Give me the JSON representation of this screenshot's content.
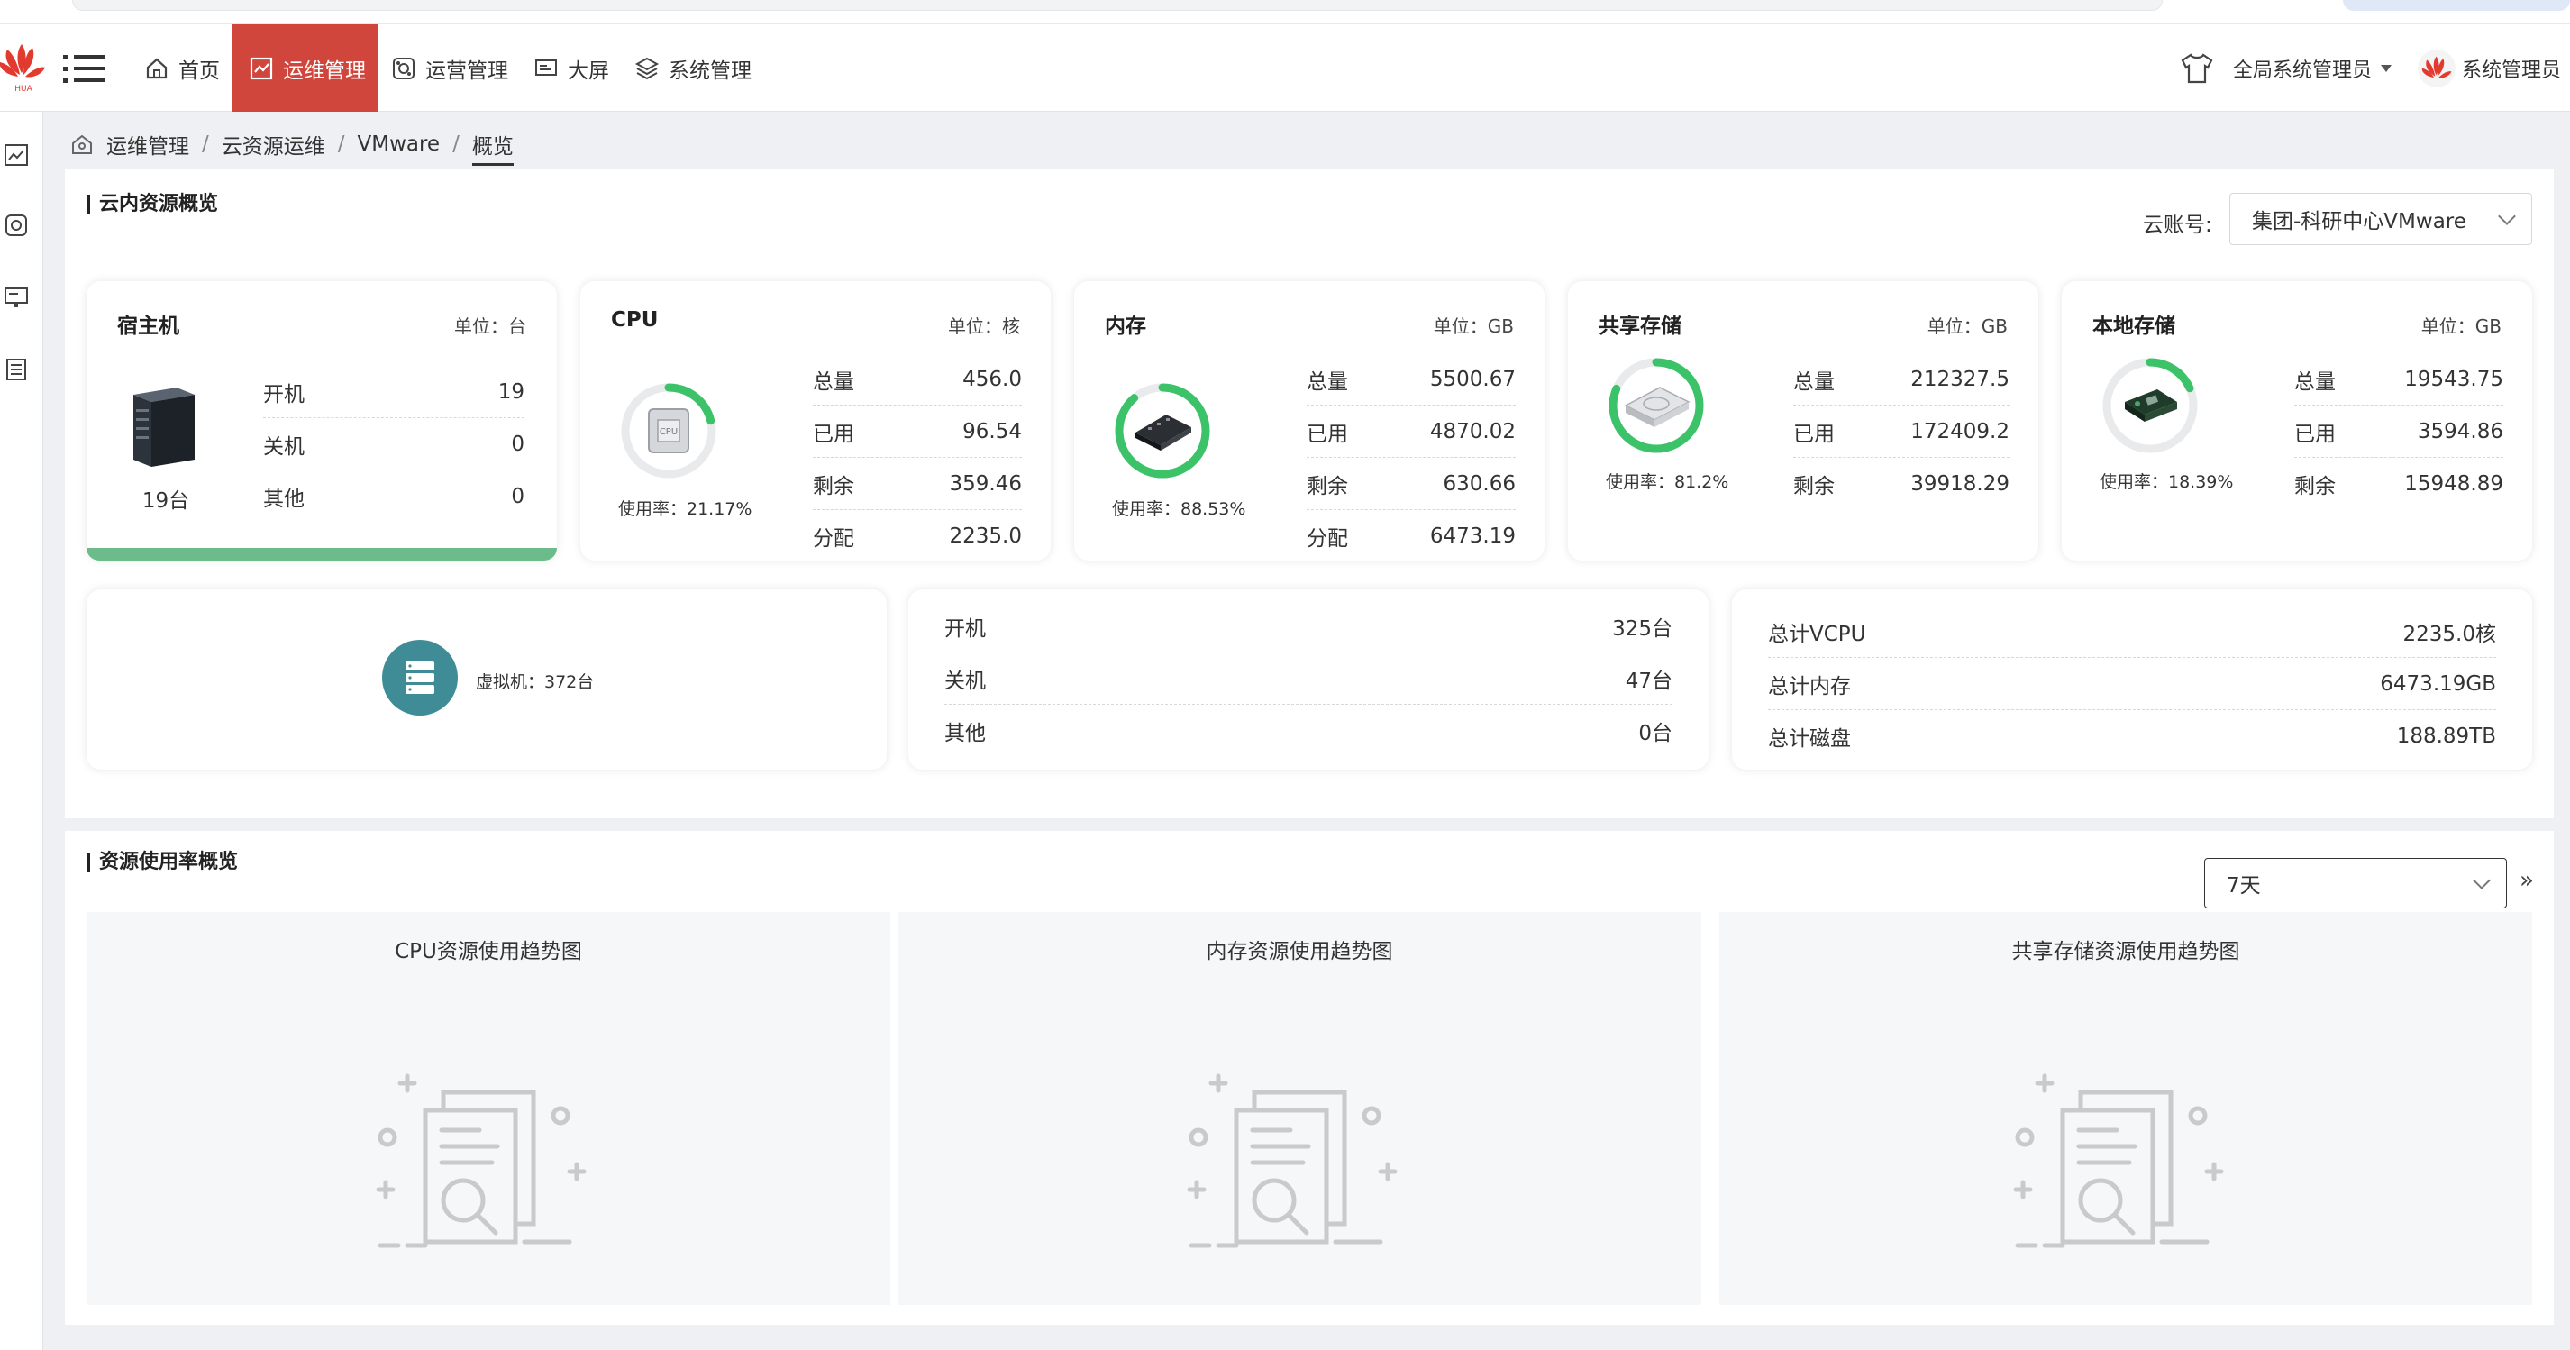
{
  "nav": {
    "items": [
      {
        "label": "首页",
        "icon": "home-icon"
      },
      {
        "label": "运维管理",
        "icon": "chart-line-icon",
        "active": true
      },
      {
        "label": "运营管理",
        "icon": "gear-network-icon"
      },
      {
        "label": "大屏",
        "icon": "monitor-icon"
      },
      {
        "label": "系统管理",
        "icon": "layers-icon"
      }
    ]
  },
  "header": {
    "role": "全局系统管理员",
    "user": "系统管理员"
  },
  "breadcrumb": [
    "运维管理",
    "云资源运维",
    "VMware",
    "概览"
  ],
  "overview": {
    "title": "云内资源概览",
    "account_label": "云账号:",
    "account_value": "集团-科研中心VMware"
  },
  "host": {
    "title": "宿主机",
    "unit": "单位：台",
    "count": "19台",
    "rows": [
      {
        "k": "开机",
        "v": "19"
      },
      {
        "k": "关机",
        "v": "0"
      },
      {
        "k": "其他",
        "v": "0"
      }
    ]
  },
  "cpu": {
    "title": "CPU",
    "unit": "单位：核",
    "rate_text": "使用率：21.17%",
    "rate": 21.17,
    "rows": [
      {
        "k": "总量",
        "v": "456.0"
      },
      {
        "k": "已用",
        "v": "96.54"
      },
      {
        "k": "剩余",
        "v": "359.46"
      },
      {
        "k": "分配",
        "v": "2235.0"
      }
    ]
  },
  "memory": {
    "title": "内存",
    "unit": "单位：GB",
    "rate_text": "使用率：88.53%",
    "rate": 88.53,
    "rows": [
      {
        "k": "总量",
        "v": "5500.67"
      },
      {
        "k": "已用",
        "v": "4870.02"
      },
      {
        "k": "剩余",
        "v": "630.66"
      },
      {
        "k": "分配",
        "v": "6473.19"
      }
    ]
  },
  "shared": {
    "title": "共享存储",
    "unit": "单位：GB",
    "rate_text": "使用率：81.2%",
    "rate": 81.2,
    "rows": [
      {
        "k": "总量",
        "v": "212327.5"
      },
      {
        "k": "已用",
        "v": "172409.2"
      },
      {
        "k": "剩余",
        "v": "39918.29"
      }
    ]
  },
  "local": {
    "title": "本地存储",
    "unit": "单位：GB",
    "rate_text": "使用率：18.39%",
    "rate": 18.39,
    "rows": [
      {
        "k": "总量",
        "v": "19543.75"
      },
      {
        "k": "已用",
        "v": "3594.86"
      },
      {
        "k": "剩余",
        "v": "15948.89"
      }
    ]
  },
  "vm": {
    "label": "虚拟机：372台",
    "rows": [
      {
        "k": "开机",
        "v": "325台"
      },
      {
        "k": "关机",
        "v": "47台"
      },
      {
        "k": "其他",
        "v": "0台"
      }
    ]
  },
  "totals": {
    "rows": [
      {
        "k": "总计VCPU",
        "v": "2235.0核"
      },
      {
        "k": "总计内存",
        "v": "6473.19GB"
      },
      {
        "k": "总计磁盘",
        "v": "188.89TB"
      }
    ]
  },
  "usage": {
    "title": "资源使用率概览",
    "range": "7天",
    "more": "»",
    "charts": [
      "CPU资源使用趋势图",
      "内存资源使用趋势图",
      "共享存储资源使用趋势图"
    ]
  },
  "colors": {
    "accent": "#d0453c",
    "ring": "#3cc36a",
    "ring_track": "#e9eaec",
    "host_bar": "#6bbc8a",
    "vm_circle": "#3f8c96"
  }
}
